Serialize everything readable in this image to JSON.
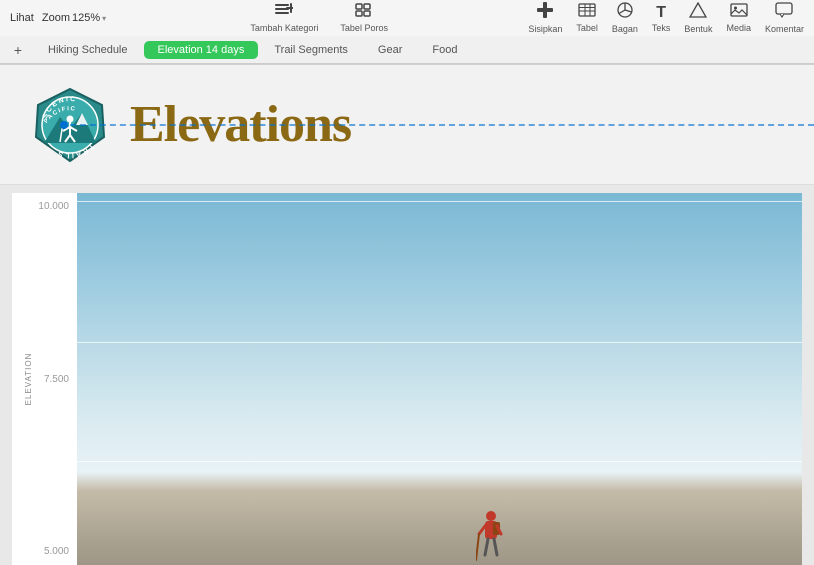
{
  "toolbar": {
    "view_label": "Lihat",
    "zoom_label": "Zoom",
    "zoom_value": "125%",
    "tambah_kategori_label": "Tambah Kategori",
    "tabel_poros_label": "Tabel Poros",
    "sisipkan_label": "Sisipkan",
    "tabel_label": "Tabel",
    "bagan_label": "Bagan",
    "teks_label": "Teks",
    "bentuk_label": "Bentuk",
    "media_label": "Media",
    "komentar_label": "Komentar"
  },
  "tabs": [
    {
      "id": "hiking-schedule",
      "label": "Hiking Schedule",
      "active": false
    },
    {
      "id": "elevation-14-days",
      "label": "Elevation 14 days",
      "active": true
    },
    {
      "id": "trail-segments",
      "label": "Trail Segments",
      "active": false
    },
    {
      "id": "gear",
      "label": "Gear",
      "active": false
    },
    {
      "id": "food",
      "label": "Food",
      "active": false
    }
  ],
  "sheet": {
    "title": "Elevations",
    "logo_alt": "Scenic Pacific Trails Logo"
  },
  "chart": {
    "y_axis_label": "ELEVATION",
    "y_ticks": [
      "10.000",
      "7.500",
      "5.000"
    ],
    "grid_lines": [
      0,
      33,
      66
    ]
  },
  "icons": {
    "add": "+",
    "view": "☰",
    "zoom_icon": "⊡",
    "tambah_kategori_icon": "≡",
    "tabel_poros_icon": "⊞",
    "sisipkan_icon": "⊕",
    "tabel_icon": "▦",
    "bagan_icon": "◷",
    "teks_icon": "T",
    "bentuk_icon": "△",
    "media_icon": "▣",
    "komentar_icon": "💬",
    "chevron": "▾"
  }
}
